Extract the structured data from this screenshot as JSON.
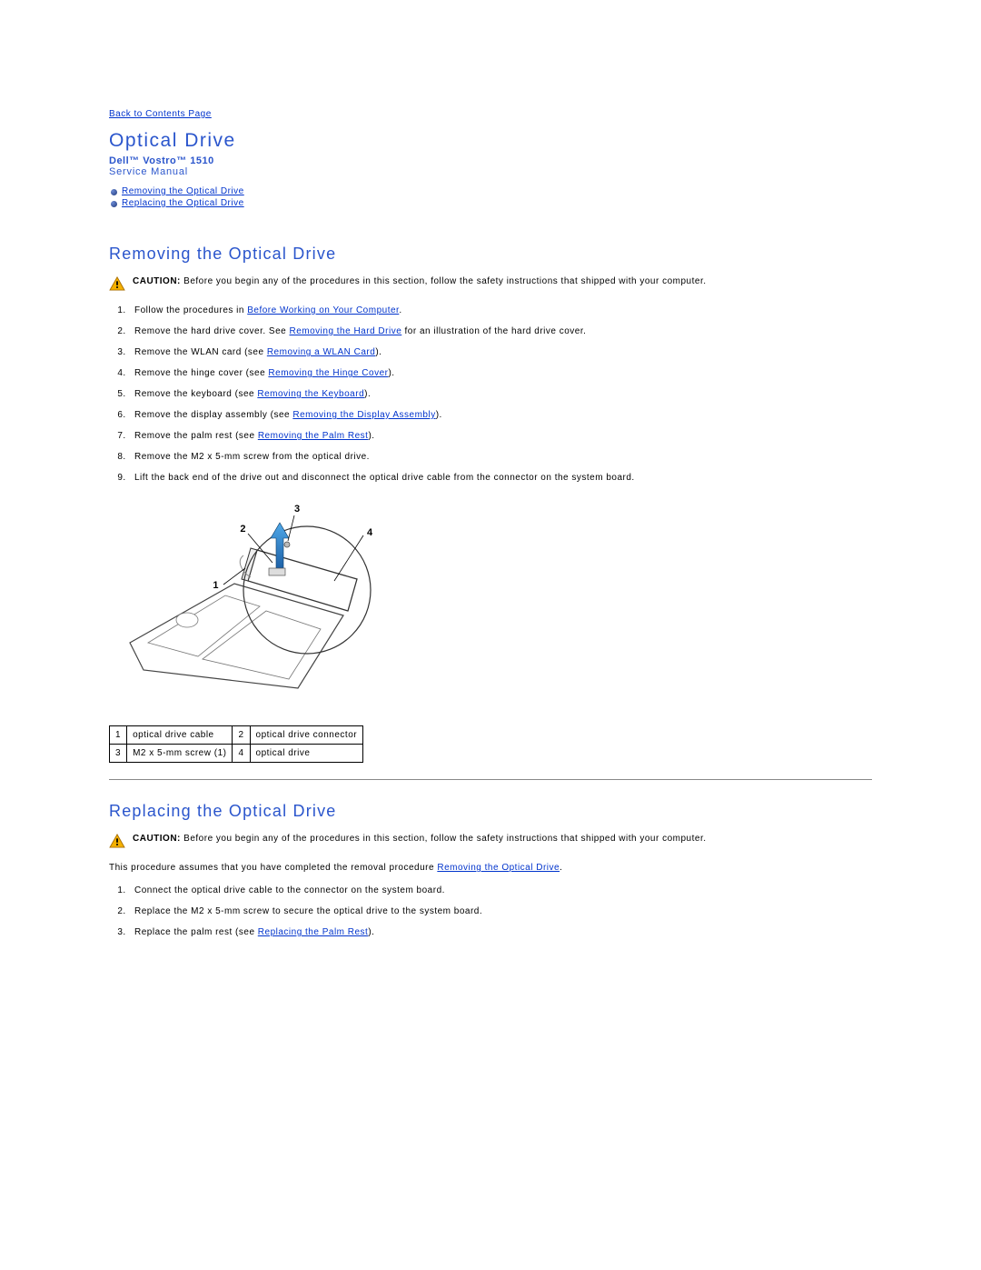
{
  "nav": {
    "back": "Back to Contents Page"
  },
  "header": {
    "title": "Optical Drive",
    "product": "Dell™ Vostro™ 1510",
    "manual": "Service Manual"
  },
  "toc": {
    "removing": "Removing the Optical Drive",
    "replacing": "Replacing the Optical Drive"
  },
  "removing": {
    "heading": "Removing the Optical Drive",
    "caution_label": "CAUTION:",
    "caution_text": " Before you begin any of the procedures in this section, follow the safety instructions that shipped with your computer.",
    "step1_a": "Follow the procedures in ",
    "step1_link": "Before Working on Your Computer",
    "step1_b": ".",
    "step2_a": "Remove the hard drive cover. See ",
    "step2_link": "Removing the Hard Drive",
    "step2_b": " for an illustration of the hard drive cover.",
    "step3_a": "Remove the WLAN card (see ",
    "step3_link": "Removing a WLAN Card",
    "step3_b": ").",
    "step4_a": "Remove the hinge cover (see ",
    "step4_link": "Removing the Hinge Cover",
    "step4_b": ").",
    "step5_a": "Remove the keyboard (see ",
    "step5_link": "Removing the Keyboard",
    "step5_b": ").",
    "step6_a": "Remove the display assembly (see ",
    "step6_link": "Removing the Display Assembly",
    "step6_b": ").",
    "step7_a": "Remove the palm rest (see ",
    "step7_link": "Removing the Palm Rest",
    "step7_b": ").",
    "step8": "Remove the M2 x 5-mm screw from the optical drive.",
    "step9": "Lift the back end of the drive out and disconnect the optical drive cable from the connector on the system board."
  },
  "diagram": {
    "l1": "1",
    "l2": "2",
    "l3": "3",
    "l4": "4"
  },
  "parts": {
    "n1": "1",
    "t1": "optical drive cable",
    "n2": "2",
    "t2": "optical drive connector",
    "n3": "3",
    "t3": "M2 x 5-mm screw (1)",
    "n4": "4",
    "t4": "optical drive"
  },
  "replacing": {
    "heading": "Replacing the Optical Drive",
    "caution_label": "CAUTION:",
    "caution_text": " Before you begin any of the procedures in this section, follow the safety instructions that shipped with your computer.",
    "assume_a": "This procedure assumes that you have completed the removal procedure ",
    "assume_link": "Removing the Optical Drive",
    "assume_b": ".",
    "step1": "Connect the optical drive cable to the connector on the system board.",
    "step2": "Replace the M2 x 5-mm screw to secure the optical drive to the system board.",
    "step3_a": "Replace the palm rest (see ",
    "step3_link": "Replacing the Palm Rest",
    "step3_b": ")."
  }
}
